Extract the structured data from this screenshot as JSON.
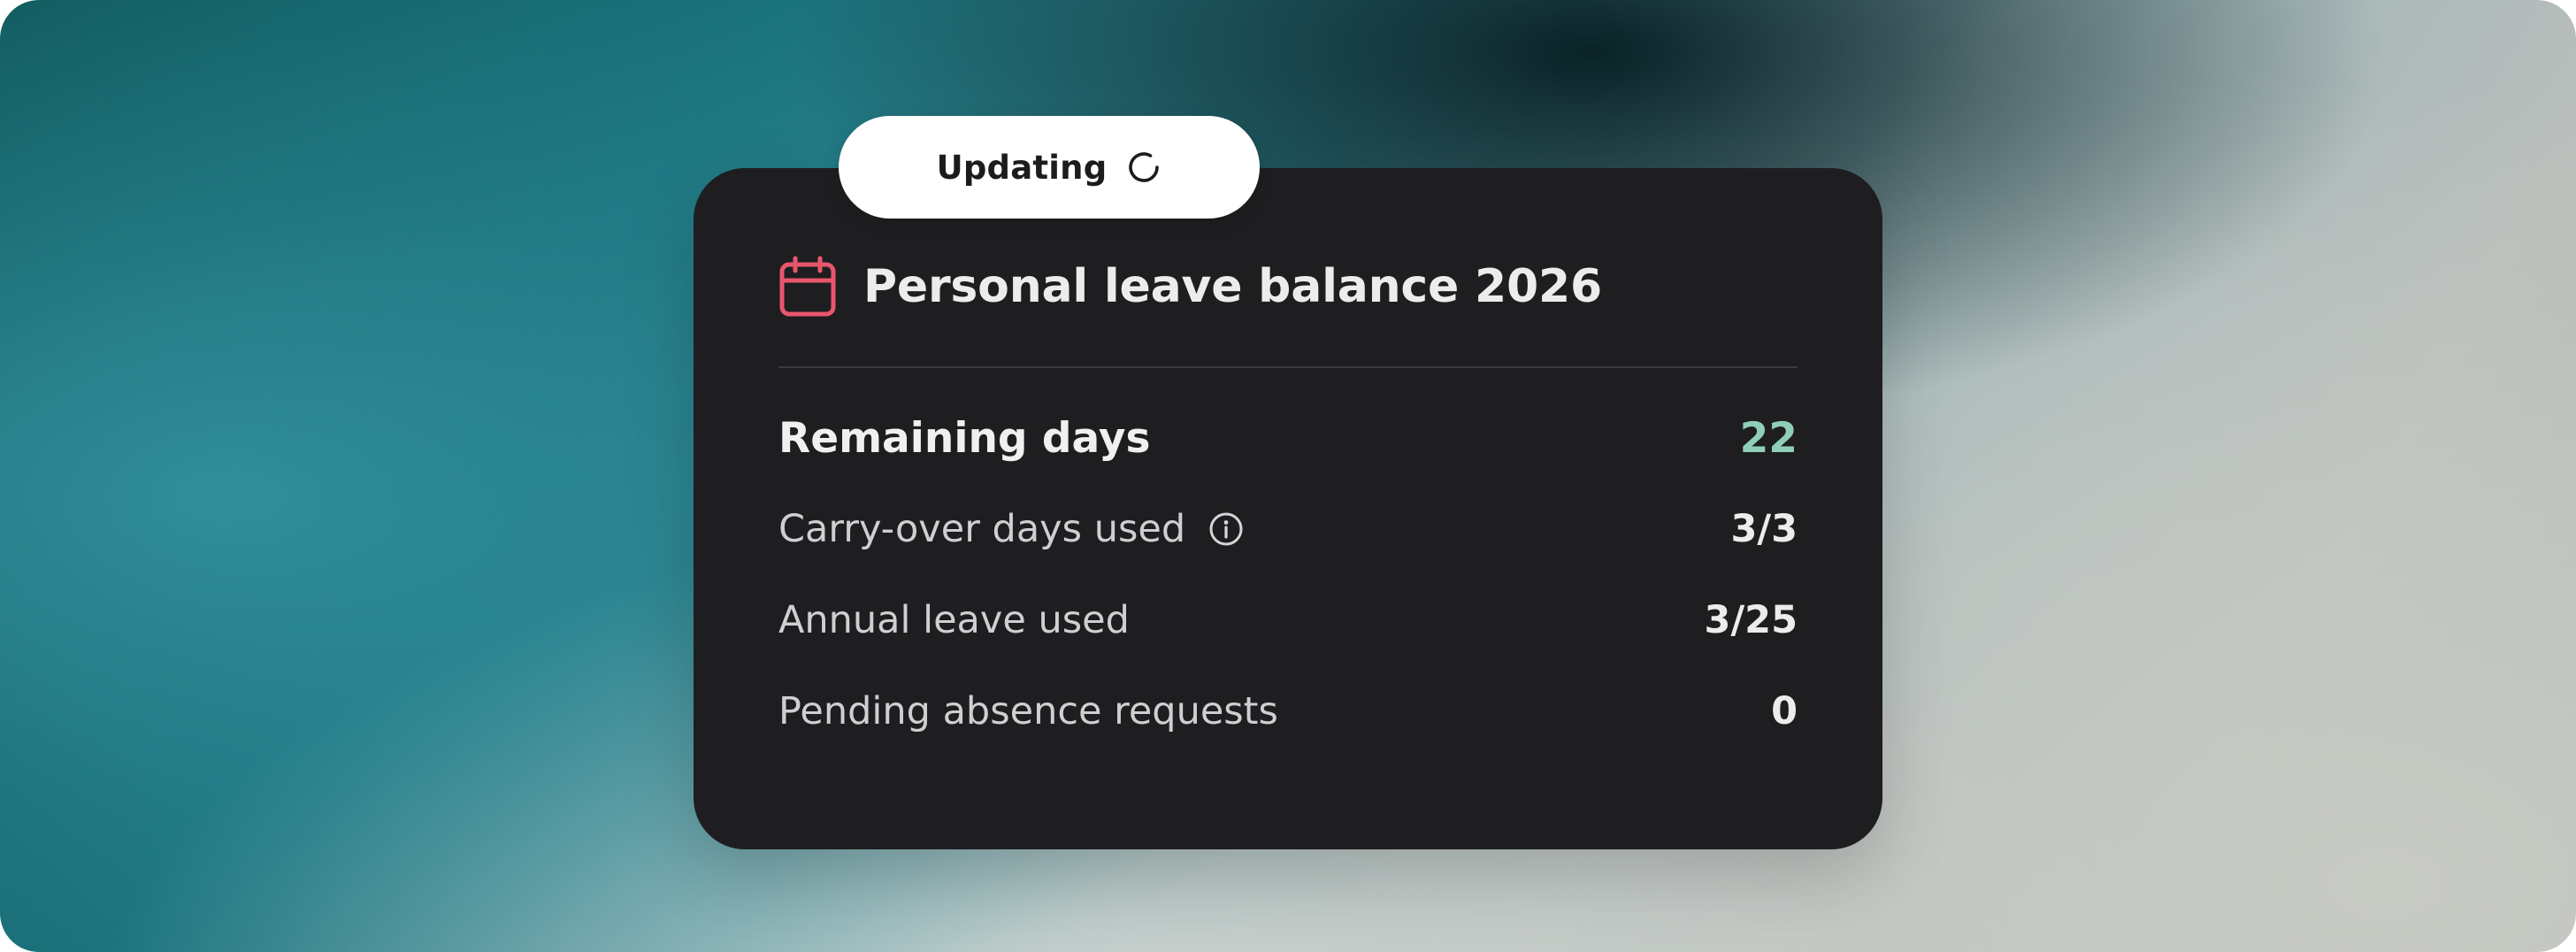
{
  "status_pill": {
    "label": "Updating",
    "icon": "loading-spinner-icon"
  },
  "card": {
    "icon": "calendar-icon",
    "title": "Personal leave balance 2026",
    "rows": [
      {
        "label": "Remaining days",
        "value": "22",
        "emphasis": true
      },
      {
        "label": "Carry-over days used",
        "value": "3/3",
        "info_icon": "info-icon"
      },
      {
        "label": "Annual leave used",
        "value": "3/25"
      },
      {
        "label": "Pending absence requests",
        "value": "0"
      }
    ]
  },
  "colors": {
    "card_background": "#1e1e20",
    "calendar_icon": "#e8566c",
    "remaining_value": "#8fcfb9",
    "pill_background": "#ffffff"
  }
}
